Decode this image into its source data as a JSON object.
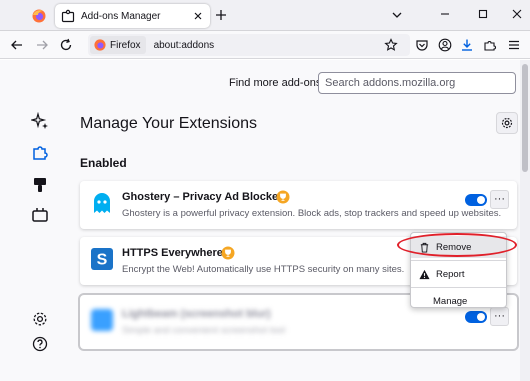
{
  "tab": {
    "title": "Add-ons Manager"
  },
  "navbar": {
    "identity_label": "Firefox",
    "url": "about:addons"
  },
  "header": {
    "find_label": "Find more add-ons",
    "search_placeholder": "Search addons.mozilla.org"
  },
  "main": {
    "title": "Manage Your Extensions",
    "section_heading": "Enabled",
    "extensions": [
      {
        "name": "Ghostery – Privacy Ad Blocker",
        "description": "Ghostery is a powerful privacy extension. Block ads, stop trackers and speed up websites.",
        "enabled": true,
        "recommended": true
      },
      {
        "name": "HTTPS Everywhere",
        "description": "Encrypt the Web! Automatically use HTTPS security on many sites.",
        "enabled": true,
        "recommended": true
      },
      {
        "name": "Lightbeam (screenshot blur)",
        "description": "Simple and convenient screenshot tool",
        "enabled": true,
        "recommended": false
      }
    ],
    "more_label": "···"
  },
  "context_menu": {
    "items": [
      {
        "label": "Remove",
        "icon": "trash-icon"
      },
      {
        "label": "Report",
        "icon": "warning-icon"
      },
      {
        "label": "Manage",
        "icon": ""
      }
    ]
  },
  "colors": {
    "accent": "#0061e0",
    "highlight": "#e0202a",
    "recommended_badge": "#f5a623",
    "ghostery": "#00aef0",
    "https_everywhere": "#1a73c8"
  }
}
